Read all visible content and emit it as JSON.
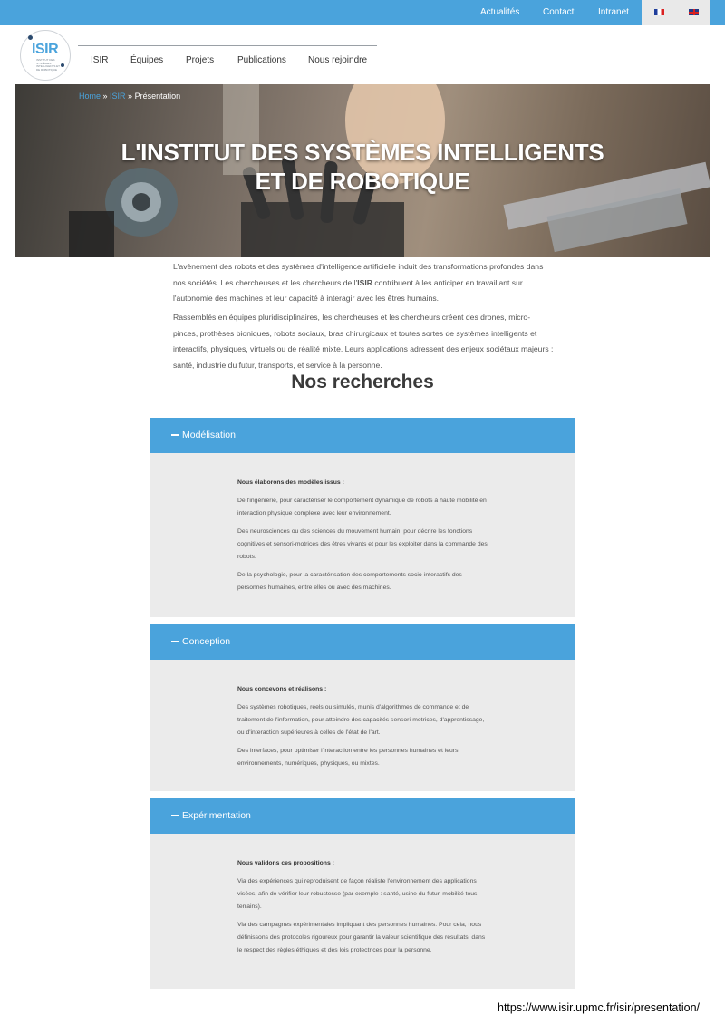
{
  "topbar": {
    "links": [
      "Actualités",
      "Contact",
      "Intranet"
    ],
    "languages": [
      "fr",
      "en"
    ]
  },
  "logo": {
    "text": "ISIR",
    "subtitle": "INSTITUT DES SYSTÈMES INTELLIGENTS ET DE ROBOTIQUE"
  },
  "nav": {
    "items": [
      "ISIR",
      "Équipes",
      "Projets",
      "Publications",
      "Nous rejoindre"
    ]
  },
  "hero": {
    "breadcrumb": {
      "home": "Home",
      "sep1": " » ",
      "parent": "ISIR",
      "sep2": " » ",
      "current": "Présentation"
    },
    "title_line1": "L'INSTITUT DES SYSTÈMES INTELLIGENTS",
    "title_line2": "ET DE ROBOTIQUE"
  },
  "intro": {
    "p1_before": "L'avènement des robots et des systèmes d'intelligence artificielle induit des transformations profondes dans nos sociétés. Les chercheuses et les chercheurs de l'",
    "p1_bold": "ISIR",
    "p1_after": " contribuent à les anticiper en travaillant sur l'autonomie des machines et leur capacité à interagir avec les êtres humains.",
    "p2": "Rassemblés en équipes pluridisciplinaires, les chercheuses et les chercheurs créent des drones, micro-pinces, prothèses bioniques, robots sociaux, bras chirurgicaux et toutes sortes de systèmes intelligents et interactifs, physiques, virtuels ou de réalité mixte. Leurs applications adressent des enjeux sociétaux majeurs : santé, industrie du futur, transports, et service à la personne."
  },
  "section_title": "Nos recherches",
  "accordions": [
    {
      "title": "Modélisation",
      "lead": "Nous élaborons des modèles issus :",
      "paragraphs": [
        "De l'ingénierie, pour caractériser le comportement dynamique de robots à haute mobilité en interaction physique complexe avec leur environnement.",
        "Des neurosciences ou des sciences du mouvement humain, pour décrire les fonctions cognitives et sensori-motrices des êtres vivants et pour les exploiter dans la commande des robots.",
        "De la psychologie, pour la caractérisation des comportements socio-interactifs des personnes humaines, entre elles ou avec des machines."
      ]
    },
    {
      "title": "Conception",
      "lead": "Nous concevons et réalisons :",
      "paragraphs": [
        "Des systèmes robotiques, réels ou simulés, munis d'algorithmes de commande et de traitement de l'information, pour atteindre des capacités sensori-motrices, d'apprentissage, ou d'interaction supérieures à celles de l'état de l'art.",
        "Des interfaces, pour optimiser l'interaction entre les personnes humaines et leurs environnements, numériques, physiques, ou mixtes."
      ]
    },
    {
      "title": "Expérimentation",
      "lead": "Nous validons ces propositions :",
      "paragraphs": [
        "Via des expériences qui reproduisent de façon réaliste l'environnement des applications visées, afin de vérifier leur robustesse (par exemple : santé, usine du futur, mobilité tous terrains).",
        "Via des campagnes expérimentales impliquant des personnes humaines. Pour cela, nous définissons des protocoles rigoureux pour garantir la valeur scientifique des résultats, dans le respect des règles éthiques et des lois protectrices pour la personne."
      ]
    }
  ],
  "footer": {
    "url": "https://www.isir.upmc.fr/isir/presentation/"
  },
  "colors": {
    "accent": "#4aa3dc",
    "panel_bg": "#ebebeb"
  }
}
